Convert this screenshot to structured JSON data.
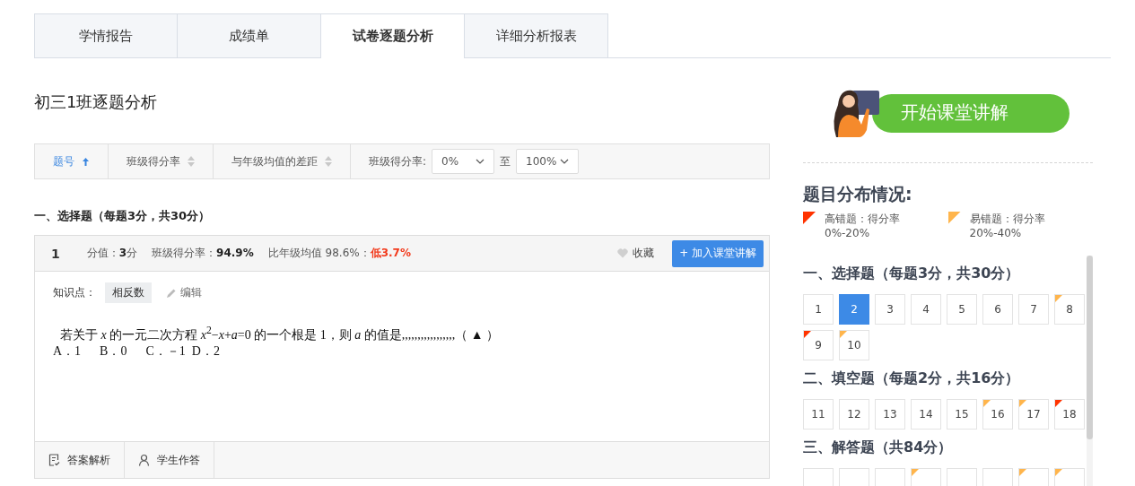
{
  "tabs": [
    {
      "label": "学情报告",
      "selected": false
    },
    {
      "label": "成绩单",
      "selected": false
    },
    {
      "label": "试卷逐题分析",
      "selected": true
    },
    {
      "label": "详细分析报表",
      "selected": false
    }
  ],
  "page_title": "初三1班逐题分析",
  "filter_bar": {
    "sorts": [
      {
        "label": "题号",
        "selected": true
      },
      {
        "label": "班级得分率",
        "selected": false
      },
      {
        "label": "与年级均值的差距",
        "selected": false
      }
    ],
    "range_label": "班级得分率:",
    "from": "0%",
    "separator": "至",
    "to": "100%"
  },
  "section_heading": "一、选择题（每题3分，共30分）",
  "question": {
    "number": "1",
    "score": "分值：**3**分",
    "rate": "班级得分率：**94.9%**",
    "compare": "比年级均值 98.6%：",
    "diff": "低3.7%",
    "favorite": "收藏",
    "add_button": "+ 加入课堂讲解",
    "knowledge_label": "知识点：",
    "knowledge_tag": "相反数",
    "edit": "编辑",
    "stem": "若关于 *x* 的一元二次方程  *x*$^{2}$−*x*+*a*=0 的一个根是  1，则  *a* 的值是,,,,,,,,,,,,,,,,,（ ▲ ）",
    "options": "A．1　  B．0　  C．－1  D．2",
    "footer_tabs": [
      "答案解析",
      "学生作答"
    ]
  },
  "sidebar": {
    "start_button": "开始课堂讲解",
    "heading": "题目分布情况:",
    "legend": [
      {
        "kind": "high",
        "label": "高错题：得分率",
        "range": "0%-20%"
      },
      {
        "kind": "easy",
        "label": "易错题：得分率",
        "range": "20%-40%"
      }
    ],
    "sections": [
      {
        "heading": "一、选择题（每题3分，共30分）",
        "items": [
          {
            "number": "1",
            "kind": "none",
            "selected": false
          },
          {
            "number": "2",
            "kind": "none",
            "selected": true
          },
          {
            "number": "3",
            "kind": "none",
            "selected": false
          },
          {
            "number": "4",
            "kind": "none",
            "selected": false
          },
          {
            "number": "5",
            "kind": "none",
            "selected": false
          },
          {
            "number": "6",
            "kind": "none",
            "selected": false
          },
          {
            "number": "7",
            "kind": "none",
            "selected": false
          },
          {
            "number": "8",
            "kind": "easy",
            "selected": false
          },
          {
            "number": "9",
            "kind": "high",
            "selected": false
          },
          {
            "number": "10",
            "kind": "easy",
            "selected": false
          }
        ]
      },
      {
        "heading": "二、填空题（每题2分，共16分）",
        "items": [
          {
            "number": "11",
            "kind": "none",
            "selected": false
          },
          {
            "number": "12",
            "kind": "none",
            "selected": false
          },
          {
            "number": "13",
            "kind": "none",
            "selected": false
          },
          {
            "number": "14",
            "kind": "none",
            "selected": false
          },
          {
            "number": "15",
            "kind": "none",
            "selected": false
          },
          {
            "number": "16",
            "kind": "easy",
            "selected": false
          },
          {
            "number": "17",
            "kind": "easy",
            "selected": false
          },
          {
            "number": "18",
            "kind": "high",
            "selected": false
          }
        ]
      },
      {
        "heading": "三、解答题（共84分）",
        "items": [
          {
            "kind": "none",
            "selected": false
          },
          {
            "kind": "none",
            "selected": false
          },
          {
            "kind": "none",
            "selected": false
          },
          {
            "kind": "easy",
            "selected": false
          },
          {
            "kind": "none",
            "selected": false
          },
          {
            "kind": "none",
            "selected": false
          },
          {
            "kind": "easy",
            "selected": false
          },
          {
            "kind": "easy",
            "selected": false
          }
        ]
      }
    ]
  }
}
